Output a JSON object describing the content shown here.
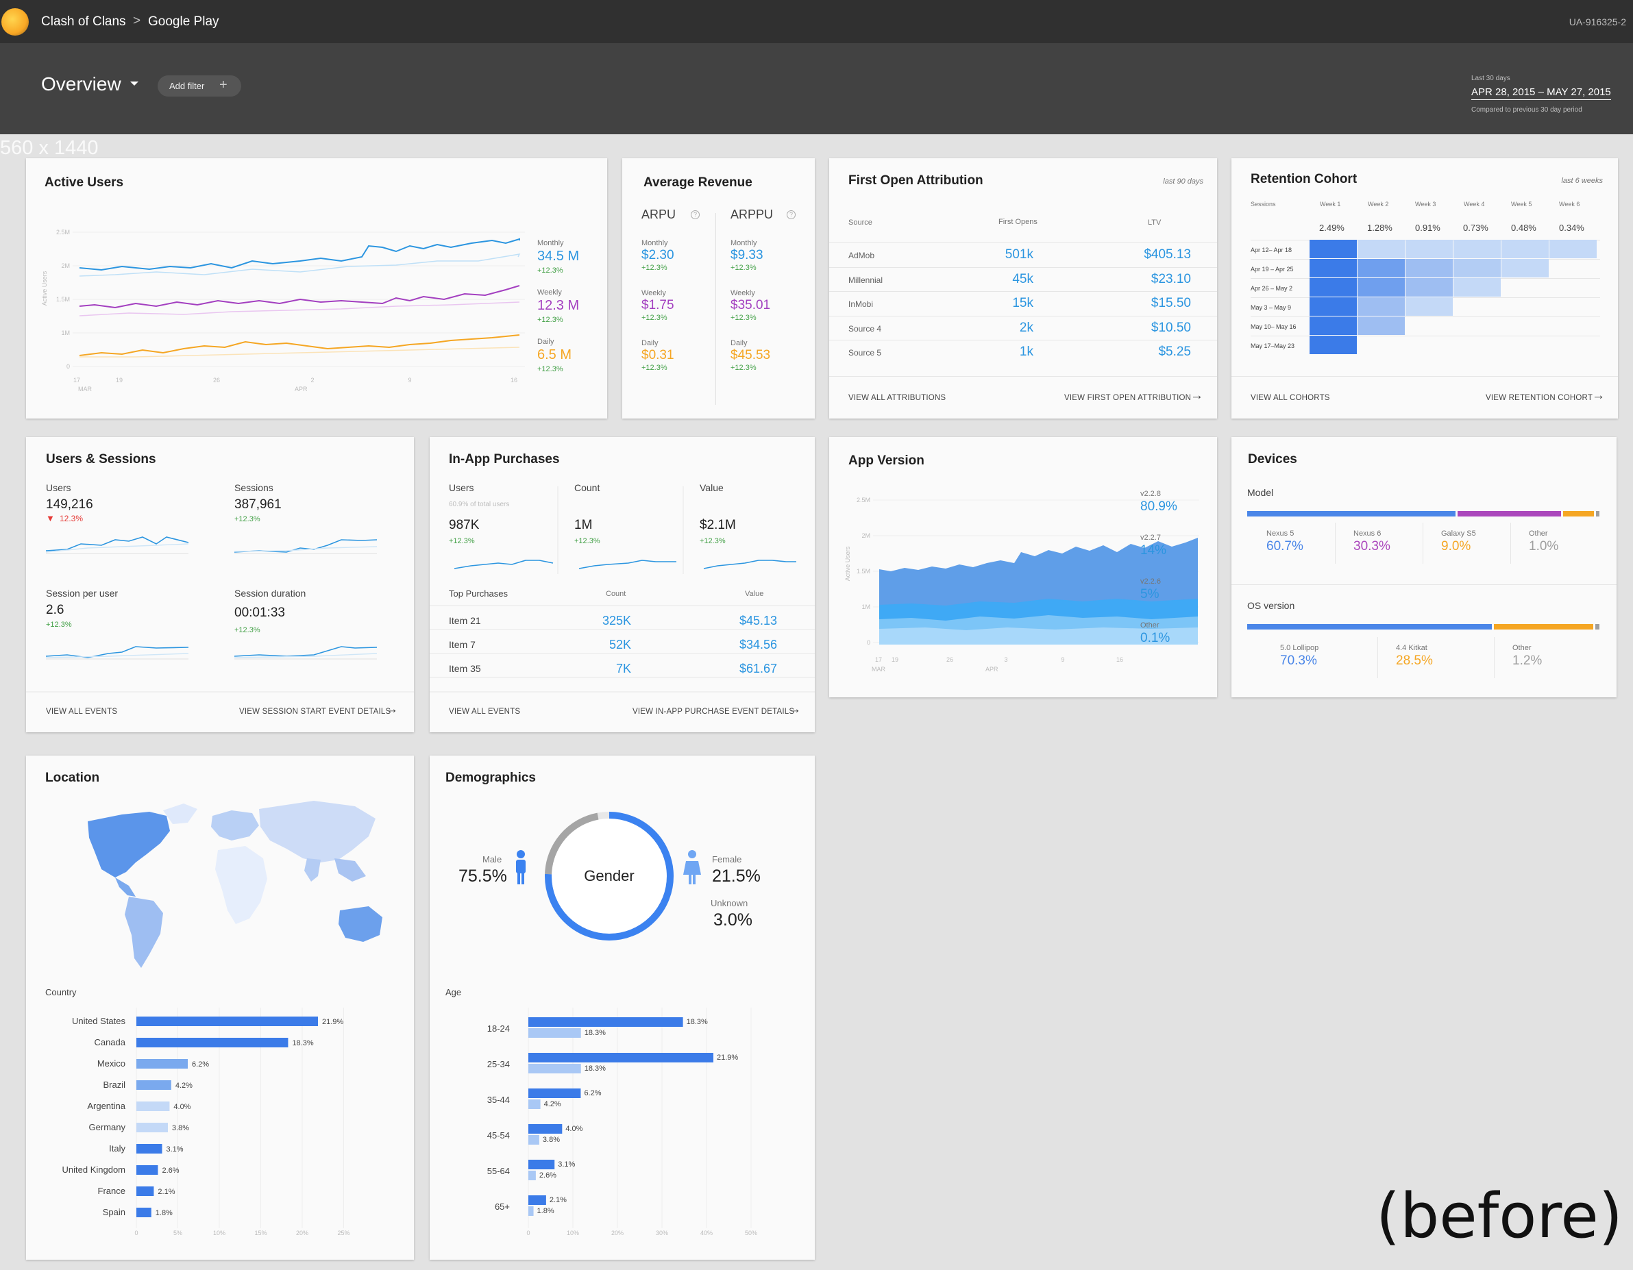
{
  "topbar": {
    "app": "Clash of Clans",
    "sep": ">",
    "store": "Google Play",
    "account": "UA-916325-2"
  },
  "subbar": {
    "title": "Overview",
    "add_filter": "Add filter",
    "add_icon": "plus-icon",
    "range_label": "Last 30 days",
    "range": "APR 28, 2015 – MAY 27, 2015",
    "compare": "Compared to previous 30 day period"
  },
  "size_label": "560 x 1440",
  "active_users": {
    "title": "Active Users",
    "ylabel": "Active Users",
    "yticks": [
      "2.5M",
      "2M",
      "1.5M",
      "1M",
      "0"
    ],
    "xticks": [
      "17",
      "19",
      "26",
      "2",
      "9",
      "16"
    ],
    "xmonths": [
      "MAR",
      "APR"
    ],
    "legend": [
      {
        "label": "Monthly",
        "value": "34.5 M",
        "change": "+12.3%"
      },
      {
        "label": "Weekly",
        "value": "12.3 M",
        "change": "+12.3%"
      },
      {
        "label": "Daily",
        "value": "6.5 M",
        "change": "+12.3%"
      }
    ]
  },
  "avg_revenue": {
    "title": "Average Revenue",
    "cols": [
      {
        "head": "ARPU",
        "rows": [
          {
            "label": "Monthly",
            "value": "$2.30",
            "change": "+12.3%"
          },
          {
            "label": "Weekly",
            "value": "$1.75",
            "change": "+12.3%"
          },
          {
            "label": "Daily",
            "value": "$0.31",
            "change": "+12.3%"
          }
        ]
      },
      {
        "head": "ARPPU",
        "rows": [
          {
            "label": "Monthly",
            "value": "$9.33",
            "change": "+12.3%"
          },
          {
            "label": "Weekly",
            "value": "$35.01",
            "change": "+12.3%"
          },
          {
            "label": "Daily",
            "value": "$45.53",
            "change": "+12.3%"
          }
        ]
      }
    ]
  },
  "attribution": {
    "title": "First Open Attribution",
    "note": "last 90 days",
    "headers": [
      "Source",
      "First Opens",
      "LTV"
    ],
    "rows": [
      [
        "AdMob",
        "501k",
        "$405.13"
      ],
      [
        "Millennial",
        "45k",
        "$23.10"
      ],
      [
        "InMobi",
        "15k",
        "$15.50"
      ],
      [
        "Source 4",
        "2k",
        "$10.50"
      ],
      [
        "Source 5",
        "1k",
        "$5.25"
      ]
    ],
    "link_left": "VIEW ALL ATTRIBUTIONS",
    "link_right": "VIEW FIRST OPEN ATTRIBUTION"
  },
  "retention": {
    "title": "Retention Cohort",
    "note": "last 6 weeks",
    "headers": [
      "Sessions",
      "Week 1",
      "Week 2",
      "Week 3",
      "Week 4",
      "Week 5",
      "Week 6"
    ],
    "avg": [
      "2.49%",
      "1.28%",
      "0.91%",
      "0.73%",
      "0.48%",
      "0.34%"
    ],
    "rows": [
      "Apr 12– Apr 18",
      "Apr 19 – Apr 25",
      "Apr 26 – May 2",
      "May 3 – May 9",
      "May 10– May 16",
      "May 17–May 23"
    ],
    "link_left": "VIEW ALL COHORTS",
    "link_right": "VIEW RETENTION COHORT"
  },
  "users_sessions": {
    "title": "Users & Sessions",
    "metrics": [
      {
        "label": "Users",
        "value": "149,216",
        "change": "12.3%"
      },
      {
        "label": "Sessions",
        "value": "387,961",
        "change": "+12.3%"
      },
      {
        "label": "Session per user",
        "value": "2.6",
        "change": "+12.3%"
      },
      {
        "label": "Session duration",
        "value": "00:01:33",
        "change": "+12.3%"
      }
    ],
    "link_left": "VIEW ALL EVENTS",
    "link_right": "VIEW SESSION START EVENT DETAILS"
  },
  "iap": {
    "title": "In-App Purchases",
    "metrics": [
      {
        "label": "Users",
        "sub": "60.9% of total users",
        "value": "987K",
        "change": "+12.3%"
      },
      {
        "label": "Count",
        "sub": "",
        "value": "1M",
        "change": "+12.3%"
      },
      {
        "label": "Value",
        "sub": "",
        "value": "$2.1M",
        "change": "+12.3%"
      }
    ],
    "top_headers": [
      "Top Purchases",
      "Count",
      "Value"
    ],
    "top": [
      [
        "Item 21",
        "325K",
        "$45.13"
      ],
      [
        "Item 7",
        "52K",
        "$34.56"
      ],
      [
        "Item 35",
        "7K",
        "$61.67"
      ]
    ],
    "link_left": "VIEW ALL EVENTS",
    "link_right": "VIEW IN-APP PURCHASE EVENT DETAILS"
  },
  "app_version": {
    "title": "App Version",
    "ylabel": "Active Users",
    "yticks": [
      "2.5M",
      "2M",
      "1.5M",
      "1M",
      "0"
    ],
    "xticks": [
      "17",
      "19",
      "26",
      "3",
      "9",
      "16"
    ],
    "xmonths": [
      "MAR",
      "APR"
    ],
    "legend": [
      {
        "label": "v2.2.8",
        "value": "80.9%"
      },
      {
        "label": "v2.2.7",
        "value": "14%"
      },
      {
        "label": "v2.2.6",
        "value": "5%"
      },
      {
        "label": "Other",
        "value": "0.1%"
      }
    ]
  },
  "devices": {
    "title": "Devices",
    "model_title": "Model",
    "models": [
      {
        "label": "Nexus 5",
        "value": "60.7%",
        "share": 0.607,
        "color": "#4a86e8"
      },
      {
        "label": "Nexus 6",
        "value": "30.3%",
        "share": 0.303,
        "color": "#ab47bc"
      },
      {
        "label": "Galaxy S5",
        "value": "9.0%",
        "share": 0.09,
        "color": "#f5a623"
      },
      {
        "label": "Other",
        "value": "1.0%",
        "share": 0.01,
        "color": "#9e9e9e"
      }
    ],
    "os_title": "OS version",
    "os": [
      {
        "label": "5.0 Lollipop",
        "value": "70.3%",
        "share": 0.703,
        "color": "#4a86e8"
      },
      {
        "label": "4.4 Kitkat",
        "value": "28.5%",
        "share": 0.285,
        "color": "#f5a623"
      },
      {
        "label": "Other",
        "value": "1.2%",
        "share": 0.012,
        "color": "#9e9e9e"
      }
    ]
  },
  "location": {
    "title": "Location",
    "country_title": "Country",
    "countries": [
      {
        "name": "United States",
        "value": 21.9,
        "label": "21.9%"
      },
      {
        "name": "Canada",
        "value": 18.3,
        "label": "18.3%"
      },
      {
        "name": "Mexico",
        "value": 6.2,
        "label": "6.2%"
      },
      {
        "name": "Brazil",
        "value": 4.2,
        "label": "4.2%"
      },
      {
        "name": "Argentina",
        "value": 4.0,
        "label": "4.0%"
      },
      {
        "name": "Germany",
        "value": 3.8,
        "label": "3.8%"
      },
      {
        "name": "Italy",
        "value": 3.1,
        "label": "3.1%"
      },
      {
        "name": "United Kingdom",
        "value": 2.6,
        "label": "2.6%"
      },
      {
        "name": "France",
        "value": 2.1,
        "label": "2.1%"
      },
      {
        "name": "Spain",
        "value": 1.8,
        "label": "1.8%"
      }
    ],
    "xticks": [
      "0",
      "5%",
      "10%",
      "15%",
      "20%",
      "25%"
    ]
  },
  "demographics": {
    "title": "Demographics",
    "gender_label": "Gender",
    "male_label": "Male",
    "male": "75.5%",
    "female_label": "Female",
    "female": "21.5%",
    "unknown_label": "Unknown",
    "unknown": "3.0%",
    "age_title": "Age",
    "ages": [
      {
        "name": "18-24",
        "a": 18.3,
        "a_label": "18.3%",
        "b": 18.3,
        "b_label": "18.3%"
      },
      {
        "name": "25-34",
        "a": 21.9,
        "a_label": "21.9%",
        "b": 18.3,
        "b_label": "18.3%"
      },
      {
        "name": "35-44",
        "a": 6.2,
        "a_label": "6.2%",
        "b": 4.2,
        "b_label": "4.2%"
      },
      {
        "name": "45-54",
        "a": 4.0,
        "a_label": "4.0%",
        "b": 3.8,
        "b_label": "3.8%"
      },
      {
        "name": "55-64",
        "a": 3.1,
        "a_label": "3.1%",
        "b": 2.6,
        "b_label": "2.6%"
      },
      {
        "name": "65+",
        "a": 2.1,
        "a_label": "2.1%",
        "b": 1.8,
        "b_label": "1.8%"
      }
    ],
    "xticks": [
      "0",
      "10%",
      "20%",
      "30%",
      "40%",
      "50%"
    ]
  },
  "watermark": "(before)"
}
